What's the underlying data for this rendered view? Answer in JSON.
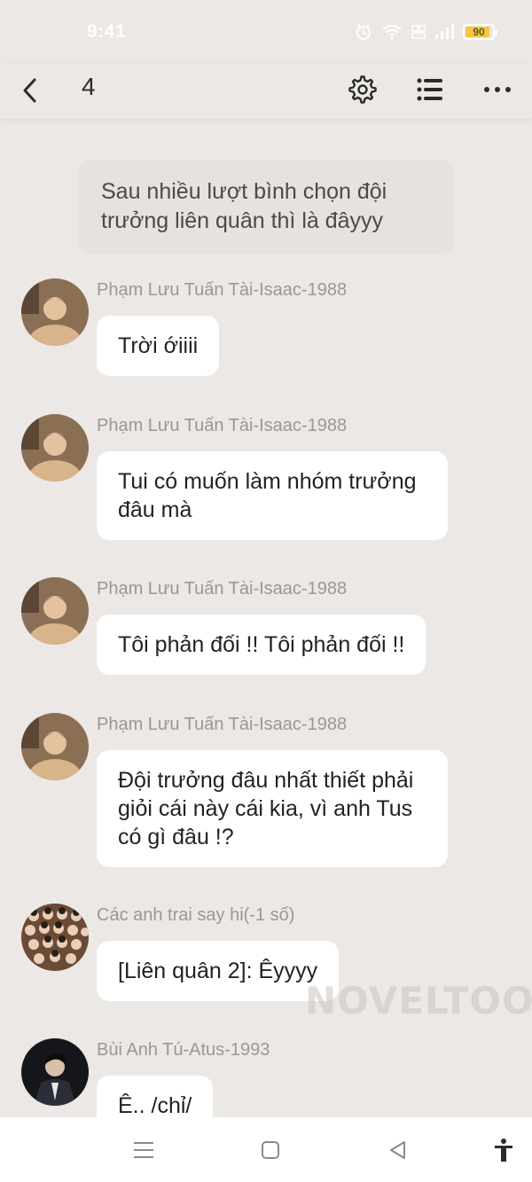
{
  "status_bar": {
    "time": "9:41",
    "battery_level": "90",
    "battery_fraction": 0.9
  },
  "app_bar": {
    "title": "4"
  },
  "icons": {
    "back": "back-arrow-icon",
    "settings": "gear-icon",
    "list": "list-icon",
    "more": "more-dots-icon"
  },
  "chat": {
    "narration": "Sau nhiều lượt bình chọn đội trưởng liên quân thì là đâyyy",
    "messages": [
      {
        "sender": "Phạm Lưu Tuấn Tài-Isaac-1988",
        "text": "Trời ớiiii"
      },
      {
        "sender": "Phạm Lưu Tuấn Tài-Isaac-1988",
        "text": "Tui có muốn làm nhóm trưởng đâu mà"
      },
      {
        "sender": "Phạm Lưu Tuấn Tài-Isaac-1988",
        "text": "Tôi phản đối !! Tôi phản đối !!"
      },
      {
        "sender": "Phạm Lưu Tuấn Tài-Isaac-1988",
        "text": "Đội trưởng đâu nhất thiết phải giỏi cái này cái kia, vì anh Tus có gì đâu !?"
      },
      {
        "sender": "Các anh trai say hi(-1 số)",
        "text": "[Liên quân 2]: Êyyyy"
      },
      {
        "sender": "Bùi Anh Tú-Atus-1993",
        "text": "Ê.. /chỉ/"
      }
    ]
  },
  "watermark": "NOVELTOON",
  "colors": {
    "background": "#ebe8e5",
    "bubble": "#ffffff",
    "sender": "#9a9796",
    "battery": "#f3c744"
  }
}
